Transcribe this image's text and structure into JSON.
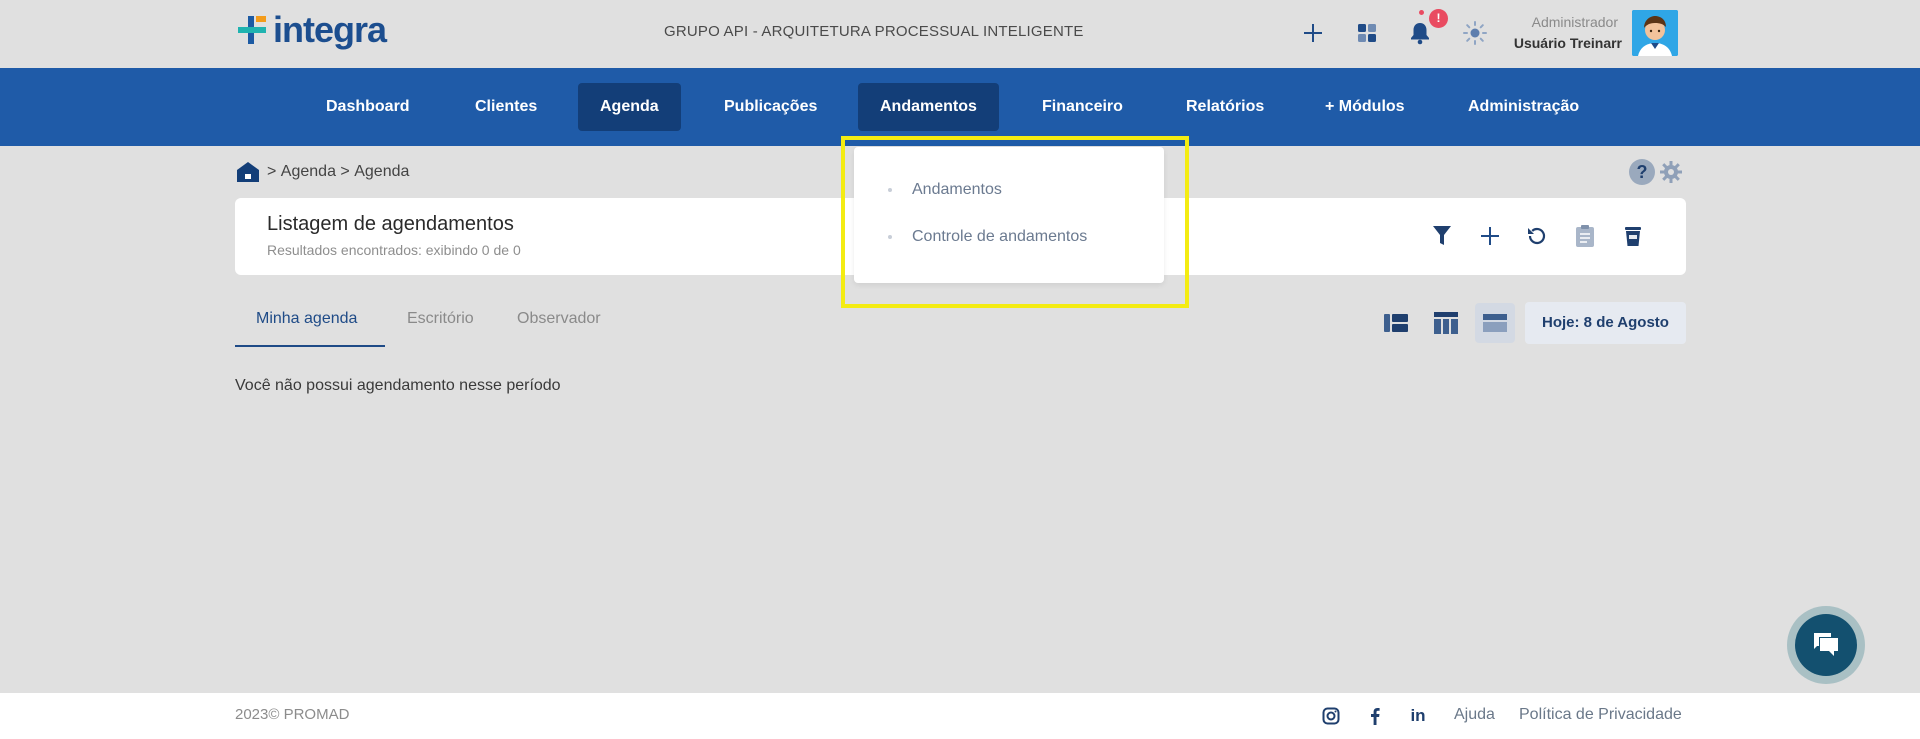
{
  "header": {
    "logo_text": "integra",
    "company": "GRUPO API - ARQUITETURA PROCESSUAL INTELIGENTE",
    "notification_count": "!",
    "user_role": "Administrador",
    "user_name": "Usuário Treinarr"
  },
  "nav": {
    "items": [
      "Dashboard",
      "Clientes",
      "Agenda",
      "Publicações",
      "Andamentos",
      "Financeiro",
      "Relatórios",
      "+ Módulos",
      "Administração"
    ],
    "active": [
      "Agenda",
      "Andamentos"
    ]
  },
  "breadcrumb": {
    "sep1": ">",
    "item1": "Agenda",
    "sep2": ">",
    "item2": "Agenda"
  },
  "card": {
    "title": "Listagem de agendamentos",
    "subtitle": "Resultados encontrados: exibindo 0 de 0"
  },
  "tabs": {
    "items": [
      "Minha agenda",
      "Escritório",
      "Observador"
    ],
    "active_index": 0
  },
  "today_button": "Hoje: 8 de Agosto",
  "empty_message": "Você não possui agendamento nesse período",
  "dropdown": {
    "items": [
      "Andamentos",
      "Controle de andamentos"
    ]
  },
  "footer": {
    "copyright": "2023©   PROMAD",
    "help": "Ajuda",
    "privacy": "Política de Privacidade",
    "linkedin_glyph": "in"
  },
  "colors": {
    "nav_bg": "#1f5ba8",
    "nav_active": "#133e78",
    "highlight": "#f4ec12",
    "accent": "#1f4b87"
  }
}
